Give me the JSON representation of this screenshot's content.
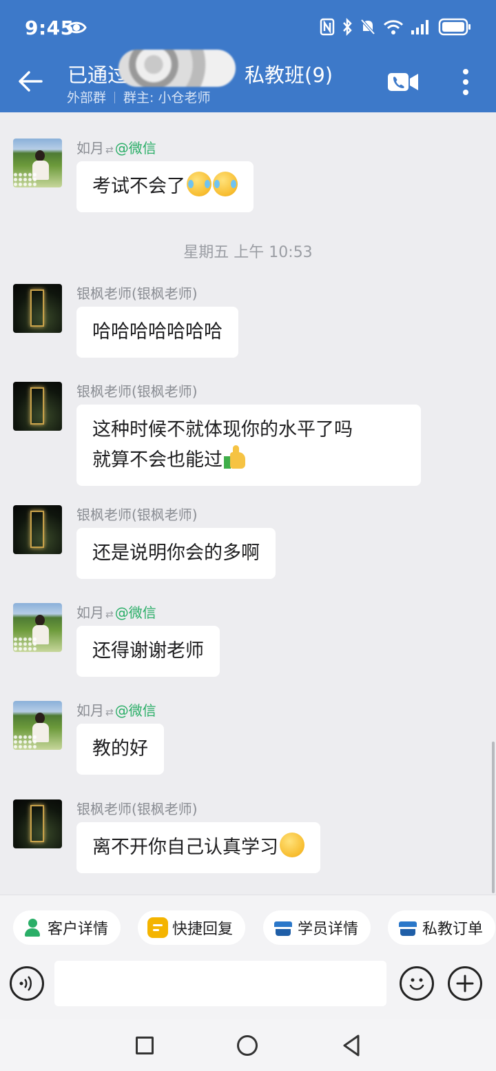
{
  "status_bar": {
    "time": "9:45",
    "icons": [
      "eye-icon",
      "nfc-icon",
      "bluetooth-icon",
      "mute-icon",
      "wifi-icon",
      "signal-icon",
      "battery-icon"
    ]
  },
  "header": {
    "title_prefix": "已通过",
    "title_suffix": "私教班(9)",
    "group_type": "外部群",
    "owner": "群主: 小仓老师",
    "colors": {
      "background": "#3d79c9"
    }
  },
  "messages": [
    {
      "type": "message",
      "sender": "如月",
      "sender_tag": "@微信",
      "avatar": "student",
      "text": "考试不会了",
      "emoji": [
        "tears",
        "tears"
      ]
    },
    {
      "type": "timestamp",
      "text": "星期五  上午 10:53"
    },
    {
      "type": "message",
      "sender": "银枫老师(银枫老师)",
      "avatar": "teacher",
      "text": "哈哈哈哈哈哈哈"
    },
    {
      "type": "message",
      "sender": "银枫老师(银枫老师)",
      "avatar": "teacher",
      "lines": [
        "这种时候不就体现你的水平了吗",
        "就算不会也能过"
      ],
      "emoji": [
        "thumbs-up"
      ]
    },
    {
      "type": "message",
      "sender": "银枫老师(银枫老师)",
      "avatar": "teacher",
      "text": "还是说明你会的多啊"
    },
    {
      "type": "message",
      "sender": "如月",
      "sender_tag": "@微信",
      "avatar": "student",
      "text": "还得谢谢老师"
    },
    {
      "type": "message",
      "sender": "如月",
      "sender_tag": "@微信",
      "avatar": "student",
      "text": "教的好"
    },
    {
      "type": "message",
      "sender": "银枫老师(银枫老师)",
      "avatar": "teacher",
      "text": "离不开你自己认真学习",
      "emoji": [
        "thinking"
      ]
    }
  ],
  "quick_actions": [
    {
      "label": "客户详情",
      "icon": "customer-icon"
    },
    {
      "label": "快捷回复",
      "icon": "quick-reply-icon"
    },
    {
      "label": "学员详情",
      "icon": "student-box-icon"
    },
    {
      "label": "私教订单",
      "icon": "order-box-icon"
    }
  ],
  "input": {
    "placeholder": "",
    "value": ""
  },
  "nav": [
    "recent-apps-button",
    "home-button",
    "back-button"
  ],
  "colors": {
    "accent": "#3d79c9",
    "wechat_tag": "#2aae67",
    "chat_bg": "#ededf0"
  }
}
